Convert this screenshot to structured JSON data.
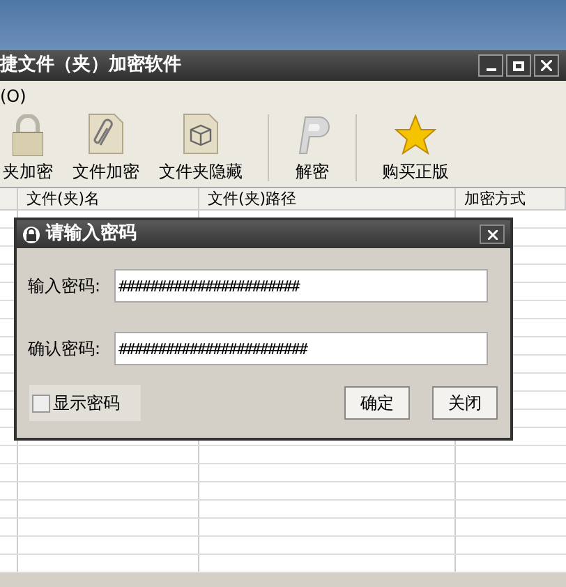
{
  "window": {
    "title": "捷文件（夹）加密软件"
  },
  "menu": [
    "(O)"
  ],
  "toolbar": [
    {
      "kind": "lock",
      "label": "夹加密"
    },
    {
      "kind": "clip",
      "label": "文件加密"
    },
    {
      "kind": "cube",
      "label": "文件夹隐藏"
    },
    {
      "kind": "separator"
    },
    {
      "kind": "decrypt",
      "label": "解密"
    },
    {
      "kind": "separator"
    },
    {
      "kind": "star",
      "label": "购买正版"
    }
  ],
  "table": {
    "columns": [
      "文件(夹)名",
      "文件(夹)路径",
      "加密方式"
    ]
  },
  "dialog": {
    "title": "请输入密码",
    "fields": [
      {
        "label": "输入密码:",
        "value": "#######################"
      },
      {
        "label": "确认密码:",
        "value": "########################"
      }
    ],
    "show_password": {
      "label": "显示密码",
      "checked": false
    },
    "buttons": [
      "确定",
      "关闭"
    ]
  }
}
